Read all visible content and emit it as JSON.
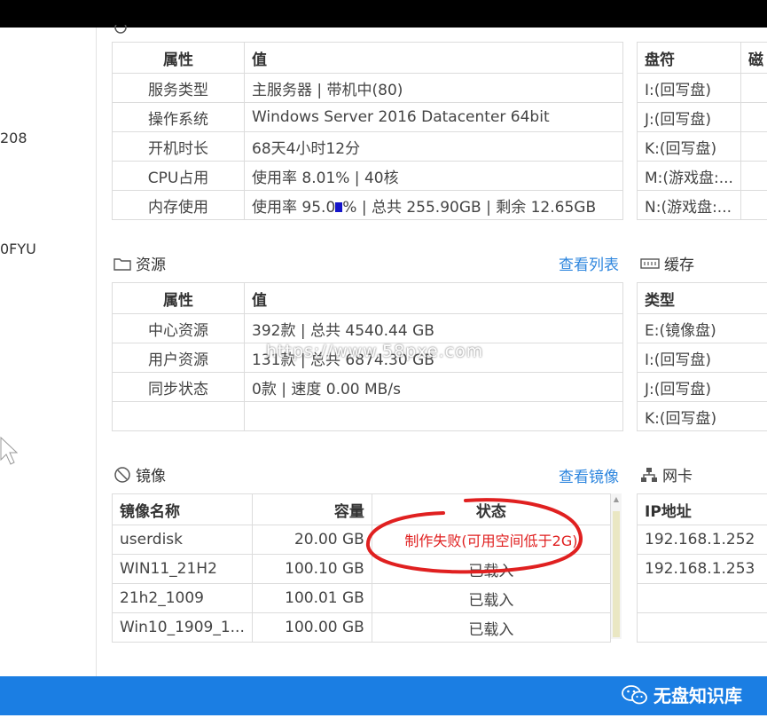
{
  "left_panel": {
    "line1": "208",
    "line2": "0FYU"
  },
  "overview": {
    "headers": [
      "属性",
      "值"
    ],
    "rows": [
      {
        "attr": "服务类型",
        "value": "主服务器 | 带机中(80)"
      },
      {
        "attr": "操作系统",
        "value": "Windows Server 2016 Datacenter 64bit"
      },
      {
        "attr": "开机时长",
        "value": "68天4小时12分"
      },
      {
        "attr": "CPU占用",
        "value": "使用率 8.01% | 40核"
      },
      {
        "attr": "内存使用",
        "value_a": "使用率 95.0",
        "value_b": "% | 总共 255.90GB | 剩余 12.65GB"
      }
    ]
  },
  "disk": {
    "headers": [
      "盘符",
      "磁"
    ],
    "rows": [
      "I:(回写盘)",
      "J:(回写盘)",
      "K:(回写盘)",
      "M:(游戏盘:...",
      "N:(游戏盘:..."
    ]
  },
  "resources": {
    "title": "资源",
    "link": "查看列表",
    "headers": [
      "属性",
      "值"
    ],
    "rows": [
      {
        "attr": "中心资源",
        "value": "392款 | 总共 4540.44 GB"
      },
      {
        "attr": "用户资源",
        "value": "131款 | 总共 6874.30 GB"
      },
      {
        "attr": "同步状态",
        "value": "0款 | 速度 0.00 MB/s"
      }
    ]
  },
  "cache": {
    "title": "缓存",
    "headers": [
      "类型"
    ],
    "rows": [
      "E:(镜像盘)",
      "I:(回写盘)",
      "J:(回写盘)",
      "K:(回写盘)"
    ]
  },
  "images": {
    "title": "镜像",
    "link": "查看镜像",
    "headers": [
      "镜像名称",
      "容量",
      "状态"
    ],
    "rows": [
      {
        "name": "userdisk",
        "size": "20.00 GB",
        "status": "制作失败(可用空间低于2G)"
      },
      {
        "name": "WIN11_21H2",
        "size": "100.10 GB",
        "status": "已载入"
      },
      {
        "name": "21h2_1009",
        "size": "100.01 GB",
        "status": "已载入"
      },
      {
        "name": "Win10_1909_1...",
        "size": "100.00 GB",
        "status": "已载入"
      }
    ]
  },
  "nic": {
    "title": "网卡",
    "headers": [
      "IP地址"
    ],
    "rows": [
      "192.168.1.252",
      "192.168.1.253"
    ]
  },
  "watermark": "https://www.58pxe.com",
  "footer": {
    "brand": "无盘知识库"
  },
  "colors": {
    "link": "#2e86de",
    "error": "#e02020",
    "footer_bar": "#1b7ee3",
    "annotation": "#e02020"
  }
}
